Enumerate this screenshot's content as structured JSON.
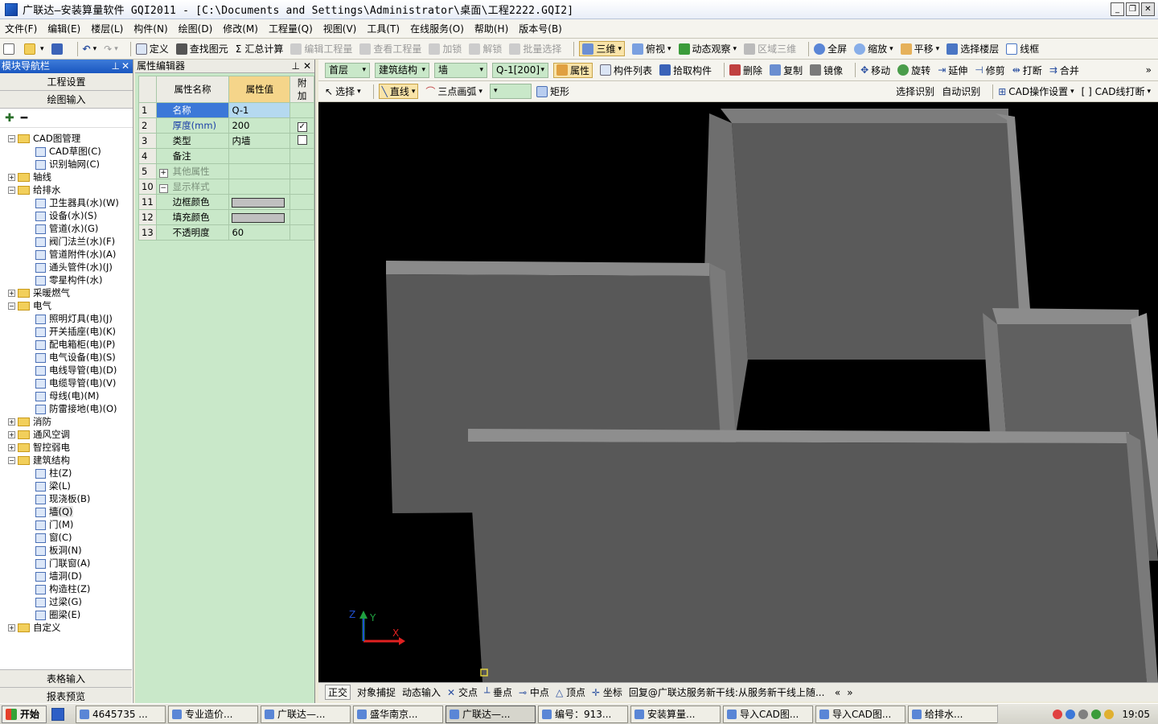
{
  "window": {
    "title": "广联达—安装算量软件 GQI2011 - [C:\\Documents and Settings\\Administrator\\桌面\\工程2222.GQI2]",
    "min": "_",
    "restore": "❐",
    "close": "✕"
  },
  "menu": [
    "文件(F)",
    "编辑(E)",
    "楼层(L)",
    "构件(N)",
    "绘图(D)",
    "修改(M)",
    "工程量(Q)",
    "视图(V)",
    "工具(T)",
    "在线服务(O)",
    "帮助(H)",
    "版本号(B)"
  ],
  "toolbar": {
    "define": "定义",
    "find": "查找图元",
    "sum_calc": "汇总计算",
    "edit_qty": "编辑工程量",
    "view_qty": "查看工程量",
    "lock": "加锁",
    "unlock": "解锁",
    "batch_select": "批量选择",
    "view3d": "三维",
    "top_view": "俯视",
    "dynamic_view": "动态观察",
    "region3d": "区域三维",
    "fullscreen": "全屏",
    "zoom": "缩放",
    "pan": "平移",
    "select_floor": "选择楼层",
    "wireframe": "线框"
  },
  "nav": {
    "title": "模块导航栏",
    "tab_project": "工程设置",
    "tab_draw": "绘图输入",
    "tree": [
      {
        "label": "CAD图管理",
        "level": 0,
        "expand": "−",
        "type": "folder"
      },
      {
        "label": "CAD草图(C)",
        "level": 1,
        "type": "leaf"
      },
      {
        "label": "识别轴网(C)",
        "level": 1,
        "type": "leaf"
      },
      {
        "label": "轴线",
        "level": 0,
        "expand": "+",
        "type": "folder"
      },
      {
        "label": "给排水",
        "level": 0,
        "expand": "−",
        "type": "folder"
      },
      {
        "label": "卫生器具(水)(W)",
        "level": 1,
        "type": "leaf"
      },
      {
        "label": "设备(水)(S)",
        "level": 1,
        "type": "leaf"
      },
      {
        "label": "管道(水)(G)",
        "level": 1,
        "type": "leaf"
      },
      {
        "label": "阀门法兰(水)(F)",
        "level": 1,
        "type": "leaf"
      },
      {
        "label": "管道附件(水)(A)",
        "level": 1,
        "type": "leaf"
      },
      {
        "label": "通头管件(水)(J)",
        "level": 1,
        "type": "leaf"
      },
      {
        "label": "零星构件(水)",
        "level": 1,
        "type": "leaf"
      },
      {
        "label": "采暖燃气",
        "level": 0,
        "expand": "+",
        "type": "folder"
      },
      {
        "label": "电气",
        "level": 0,
        "expand": "−",
        "type": "folder"
      },
      {
        "label": "照明灯具(电)(J)",
        "level": 1,
        "type": "leaf"
      },
      {
        "label": "开关插座(电)(K)",
        "level": 1,
        "type": "leaf"
      },
      {
        "label": "配电箱柜(电)(P)",
        "level": 1,
        "type": "leaf"
      },
      {
        "label": "电气设备(电)(S)",
        "level": 1,
        "type": "leaf"
      },
      {
        "label": "电线导管(电)(D)",
        "level": 1,
        "type": "leaf"
      },
      {
        "label": "电缆导管(电)(V)",
        "level": 1,
        "type": "leaf"
      },
      {
        "label": "母线(电)(M)",
        "level": 1,
        "type": "leaf"
      },
      {
        "label": "防雷接地(电)(O)",
        "level": 1,
        "type": "leaf"
      },
      {
        "label": "消防",
        "level": 0,
        "expand": "+",
        "type": "folder"
      },
      {
        "label": "通风空调",
        "level": 0,
        "expand": "+",
        "type": "folder"
      },
      {
        "label": "智控弱电",
        "level": 0,
        "expand": "+",
        "type": "folder"
      },
      {
        "label": "建筑结构",
        "level": 0,
        "expand": "−",
        "type": "folder"
      },
      {
        "label": "柱(Z)",
        "level": 1,
        "type": "leaf"
      },
      {
        "label": "梁(L)",
        "level": 1,
        "type": "leaf"
      },
      {
        "label": "现浇板(B)",
        "level": 1,
        "type": "leaf"
      },
      {
        "label": "墙(Q)",
        "level": 1,
        "type": "leaf",
        "selected": true
      },
      {
        "label": "门(M)",
        "level": 1,
        "type": "leaf"
      },
      {
        "label": "窗(C)",
        "level": 1,
        "type": "leaf"
      },
      {
        "label": "板洞(N)",
        "level": 1,
        "type": "leaf"
      },
      {
        "label": "门联窗(A)",
        "level": 1,
        "type": "leaf"
      },
      {
        "label": "墙洞(D)",
        "level": 1,
        "type": "leaf"
      },
      {
        "label": "构造柱(Z)",
        "level": 1,
        "type": "leaf"
      },
      {
        "label": "过梁(G)",
        "level": 1,
        "type": "leaf"
      },
      {
        "label": "圈梁(E)",
        "level": 1,
        "type": "leaf"
      },
      {
        "label": "自定义",
        "level": 0,
        "expand": "+",
        "type": "folder"
      }
    ],
    "tab_table": "表格输入",
    "tab_report": "报表预览"
  },
  "props": {
    "title": "属性编辑器",
    "col_name": "属性名称",
    "col_value": "属性值",
    "col_add": "附加",
    "rows": [
      {
        "num": "1",
        "name": "名称",
        "value": "Q-1",
        "add": "",
        "selected": true
      },
      {
        "num": "2",
        "name": "厚度(mm)",
        "value": "200",
        "add": "✓",
        "blue": true
      },
      {
        "num": "3",
        "name": "类型",
        "value": "内墙",
        "add": " "
      },
      {
        "num": "4",
        "name": "备注",
        "value": "",
        "add": ""
      },
      {
        "num": "5",
        "name": "其他属性",
        "value": "",
        "add": "",
        "expand": "+",
        "muted": true
      },
      {
        "num": "10",
        "name": "显示样式",
        "value": "",
        "add": "",
        "expand": "−",
        "muted": true
      },
      {
        "num": "11",
        "name": "边框颜色",
        "value": "",
        "add": "",
        "swatch": true
      },
      {
        "num": "12",
        "name": "填充颜色",
        "value": "",
        "add": "",
        "swatch": true
      },
      {
        "num": "13",
        "name": "不透明度",
        "value": "60",
        "add": ""
      }
    ]
  },
  "drawbar1": {
    "floor": "首层",
    "category": "建筑结构",
    "component": "墙",
    "instance": "Q-1[200]",
    "property": "属性",
    "list": "构件列表",
    "pick": "拾取构件",
    "delete": "删除",
    "copy": "复制",
    "mirror": "镜像",
    "move": "移动",
    "rotate": "旋转",
    "extend": "延伸",
    "trim": "修剪",
    "break": "打断",
    "merge": "合并",
    "more": "»"
  },
  "drawbar2": {
    "select": "选择",
    "line": "直线",
    "arc": "三点画弧",
    "rect": "矩形",
    "select_recognize": "选择识别",
    "auto_recognize": "自动识别",
    "cad_settings": "CAD操作设置",
    "cad_break": "[ ] CAD线打断"
  },
  "axis": {
    "x": "X",
    "y": "Y",
    "z": "Z"
  },
  "status": {
    "ortho": "正交",
    "snap": "对象捕捉",
    "dyn_input": "动态输入",
    "intersect": "交点",
    "perp": "垂点",
    "mid": "中点",
    "vertex": "顶点",
    "coord": "坐标",
    "message": "回复@广联达服务新干线:从服务新干线上随...",
    "prev": "«",
    "next": "»"
  },
  "taskbar": {
    "start": "开始",
    "tasks": [
      "4645735 ...",
      "专业造价...",
      "广联达—...",
      "盛华南京...",
      "广联达—...",
      "编号：913...",
      "安装算量...",
      "导入CAD图...",
      "导入CAD图...",
      "给排水..."
    ],
    "active_index": 4,
    "clock": "19:05"
  }
}
